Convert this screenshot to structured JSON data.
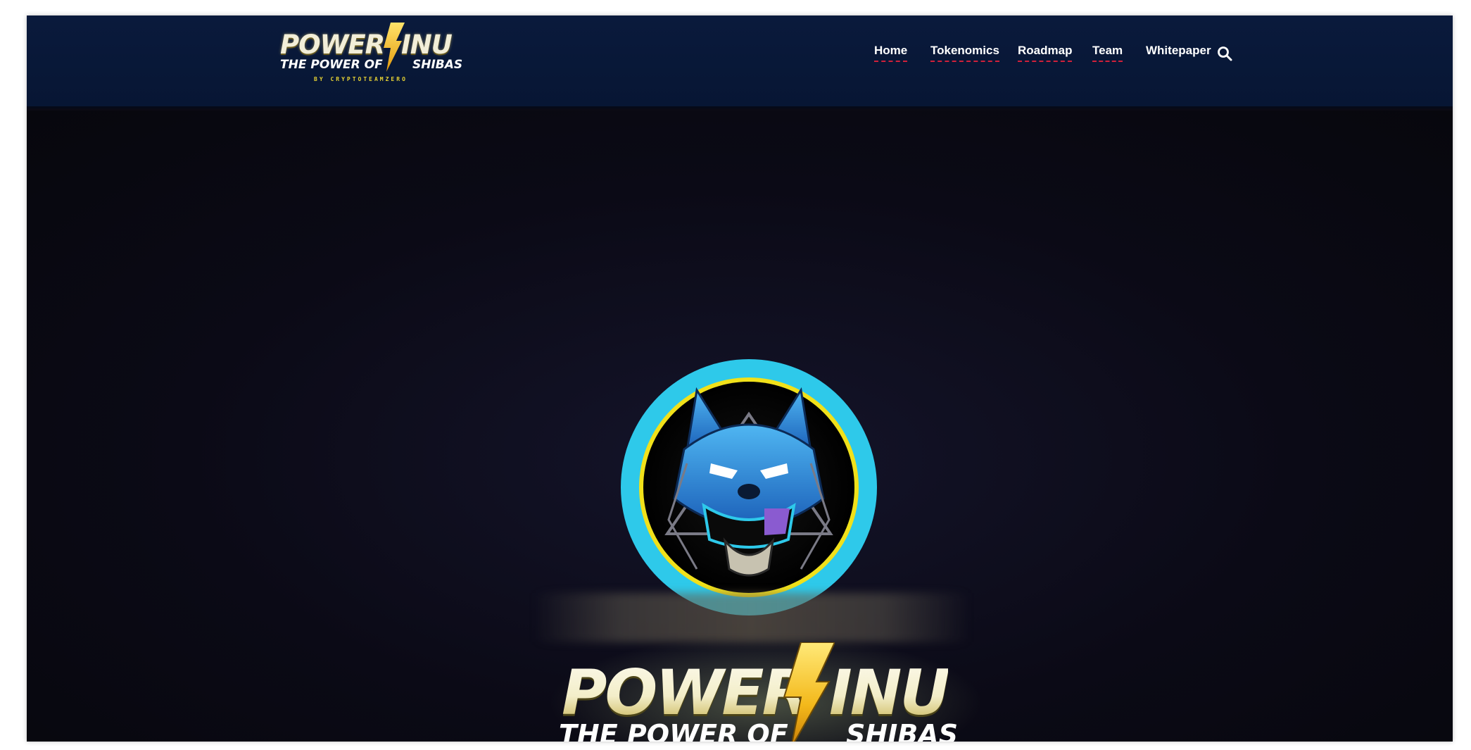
{
  "brand": {
    "logo_power": "POWER",
    "logo_inu": "INU",
    "tagline_left": "THE POWER OF",
    "tagline_right": "SHIBAS",
    "byline": "BY CRYPTOTEAMZERO"
  },
  "nav": {
    "items": [
      {
        "label": "Home"
      },
      {
        "label": "Tokenomics"
      },
      {
        "label": "Roadmap"
      },
      {
        "label": "Team"
      },
      {
        "label": "Whitepaper"
      }
    ],
    "search_icon": "search-icon"
  },
  "hero": {
    "mascot": "wolf-mascot-badge",
    "logo_power": "POWER",
    "logo_inu": "INU",
    "tagline_left": "THE POWER OF",
    "tagline_right": "SHIBAS"
  },
  "colors": {
    "header_bg": "#071634",
    "hero_bg": "#0b0a14",
    "accent_underline": "#d0203a",
    "badge_ring": "#2ec9ea",
    "badge_inner_ring": "#f1e11a",
    "bolt_yellow": "#f5c518"
  }
}
